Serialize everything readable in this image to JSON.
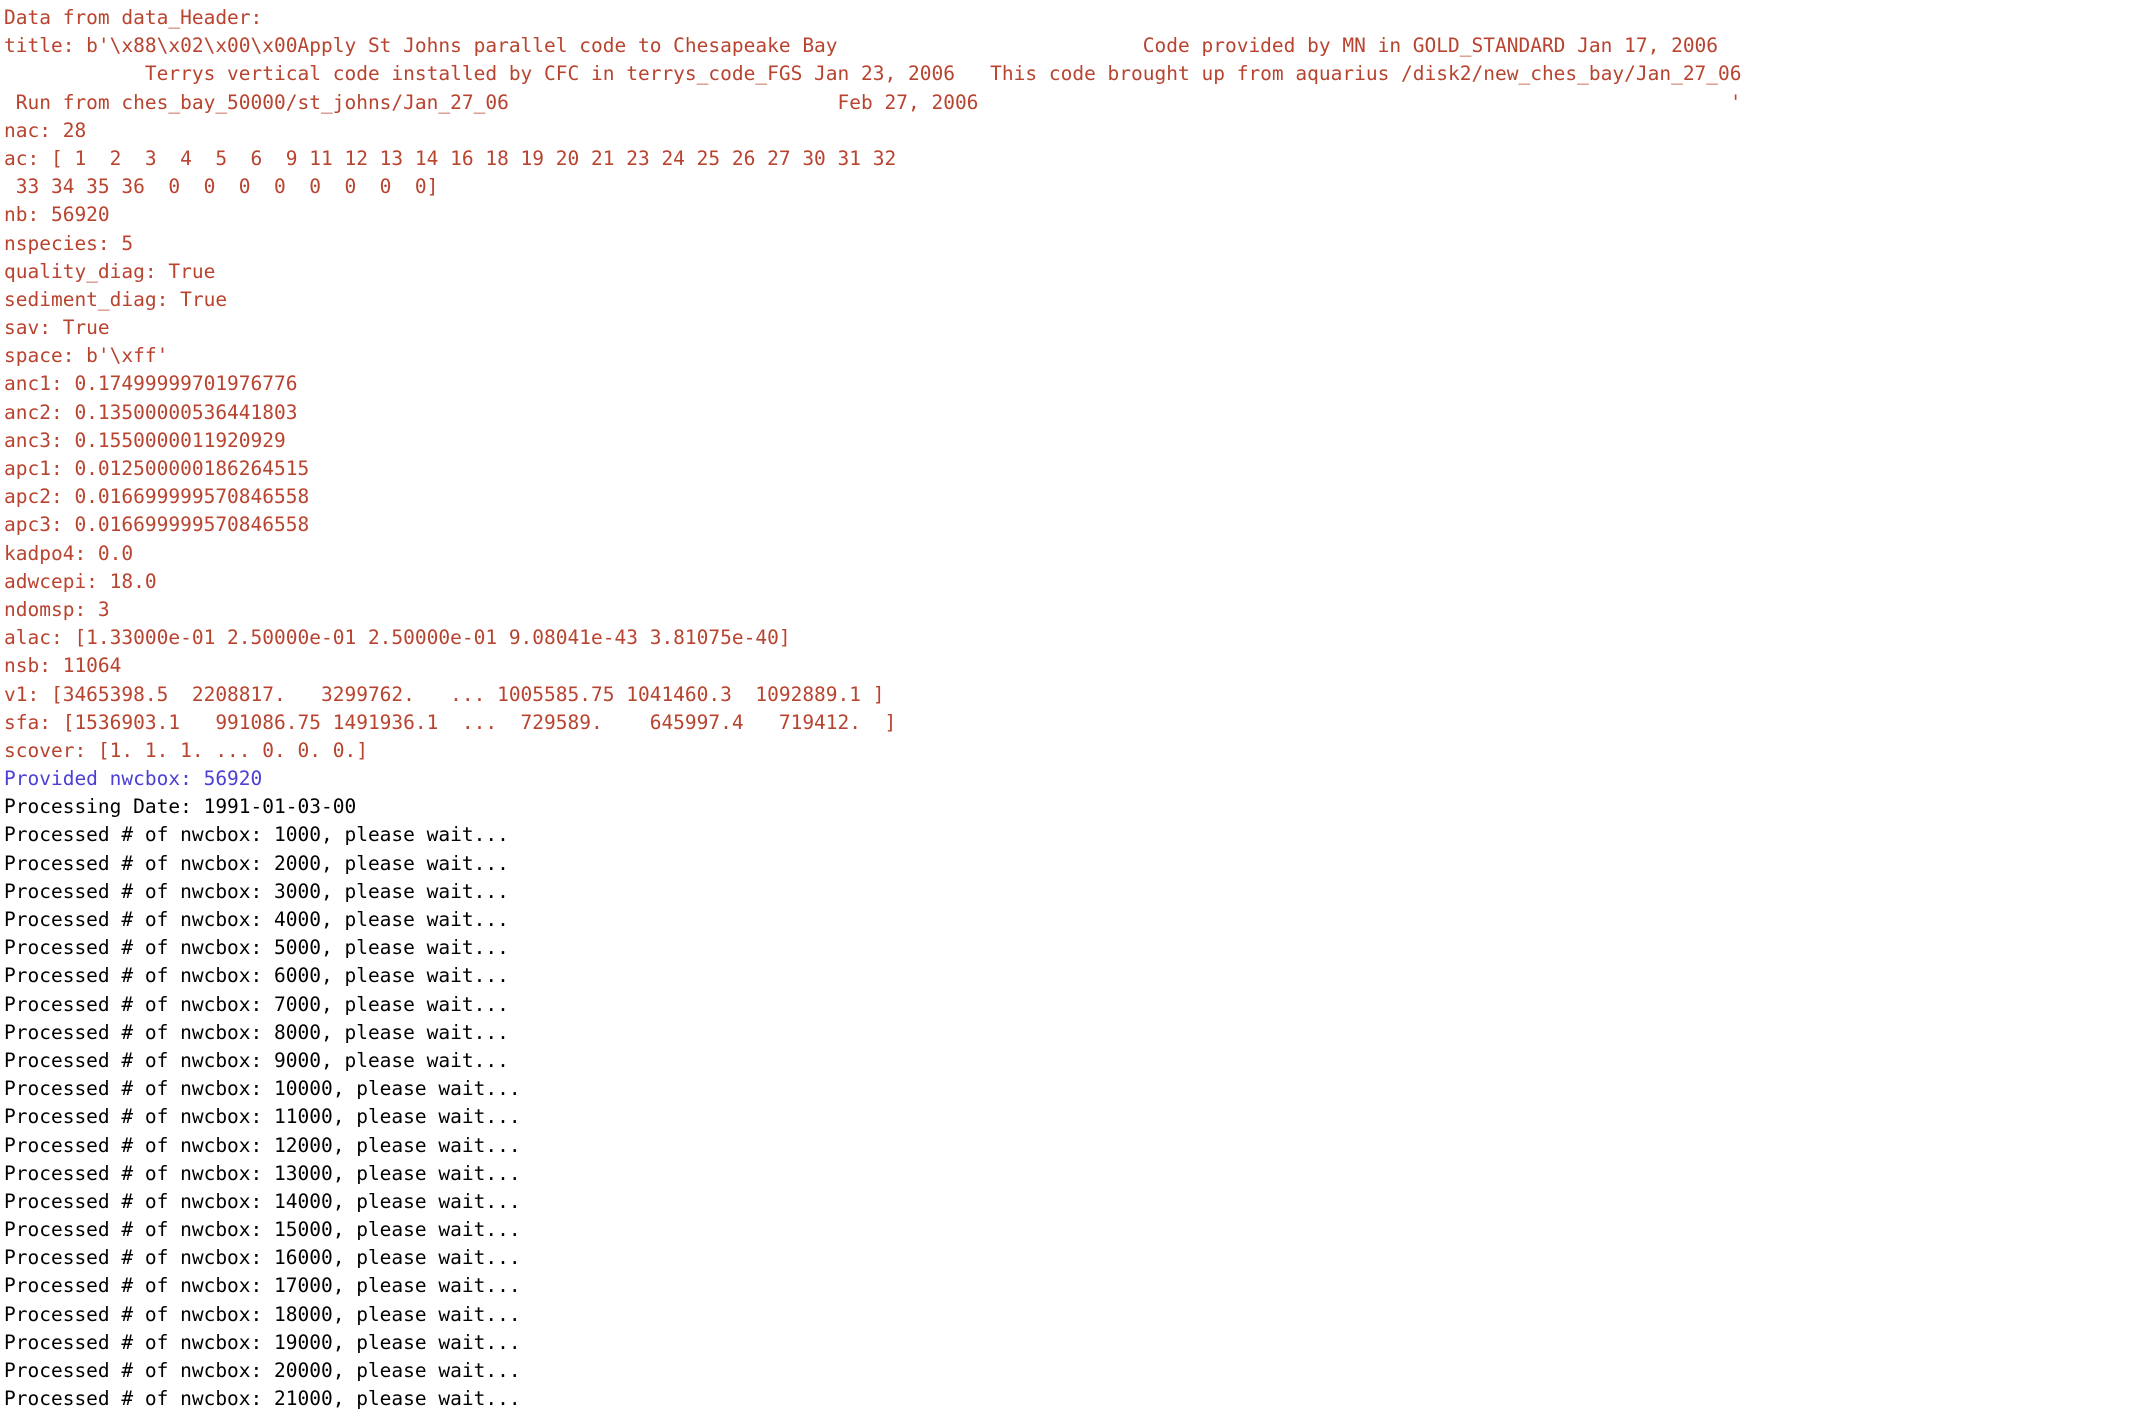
{
  "terminal": {
    "background_color": "#ffffff",
    "colors": {
      "stderr": "#b8432f",
      "info": "#4b3fd4",
      "stdout": "#000000"
    },
    "font_size_px": 19.5,
    "line_height_px": 28.2
  },
  "lines": [
    {
      "stream": "stderr",
      "text": "Data from data_Header:"
    },
    {
      "stream": "stderr",
      "text": "title: b'\\x88\\x02\\x00\\x00Apply St Johns parallel code to Chesapeake Bay                          Code provided by MN in GOLD_STANDARD Jan 17, 2006"
    },
    {
      "stream": "stderr",
      "text": "            Terrys vertical code installed by CFC in terrys_code_FGS Jan 23, 2006   This code brought up from aquarius /disk2/new_ches_bay/Jan_27_06"
    },
    {
      "stream": "stderr",
      "text": " Run from ches_bay_50000/st_johns/Jan_27_06                            Feb 27, 2006                                                                '"
    },
    {
      "stream": "stderr",
      "text": "nac: 28"
    },
    {
      "stream": "stderr",
      "text": "ac: [ 1  2  3  4  5  6  9 11 12 13 14 16 18 19 20 21 23 24 25 26 27 30 31 32"
    },
    {
      "stream": "stderr",
      "text": " 33 34 35 36  0  0  0  0  0  0  0  0]"
    },
    {
      "stream": "stderr",
      "text": "nb: 56920"
    },
    {
      "stream": "stderr",
      "text": "nspecies: 5"
    },
    {
      "stream": "stderr",
      "text": "quality_diag: True"
    },
    {
      "stream": "stderr",
      "text": "sediment_diag: True"
    },
    {
      "stream": "stderr",
      "text": "sav: True"
    },
    {
      "stream": "stderr",
      "text": "space: b'\\xff'"
    },
    {
      "stream": "stderr",
      "text": "anc1: 0.17499999701976776"
    },
    {
      "stream": "stderr",
      "text": "anc2: 0.13500000536441803"
    },
    {
      "stream": "stderr",
      "text": "anc3: 0.1550000011920929"
    },
    {
      "stream": "stderr",
      "text": "apc1: 0.012500000186264515"
    },
    {
      "stream": "stderr",
      "text": "apc2: 0.016699999570846558"
    },
    {
      "stream": "stderr",
      "text": "apc3: 0.016699999570846558"
    },
    {
      "stream": "stderr",
      "text": "kadpo4: 0.0"
    },
    {
      "stream": "stderr",
      "text": "adwcepi: 18.0"
    },
    {
      "stream": "stderr",
      "text": "ndomsp: 3"
    },
    {
      "stream": "stderr",
      "text": "alac: [1.33000e-01 2.50000e-01 2.50000e-01 9.08041e-43 3.81075e-40]"
    },
    {
      "stream": "stderr",
      "text": "nsb: 11064"
    },
    {
      "stream": "stderr",
      "text": "v1: [3465398.5  2208817.   3299762.   ... 1005585.75 1041460.3  1092889.1 ]"
    },
    {
      "stream": "stderr",
      "text": "sfa: [1536903.1   991086.75 1491936.1  ...  729589.    645997.4   719412.  ]"
    },
    {
      "stream": "stderr",
      "text": "scover: [1. 1. 1. ... 0. 0. 0.]"
    },
    {
      "stream": "info",
      "text": "Provided nwcbox: 56920"
    },
    {
      "stream": "stdout",
      "text": "Processing Date: 1991-01-03-00"
    },
    {
      "stream": "stdout",
      "text": "Processed # of nwcbox: 1000, please wait..."
    },
    {
      "stream": "stdout",
      "text": "Processed # of nwcbox: 2000, please wait..."
    },
    {
      "stream": "stdout",
      "text": "Processed # of nwcbox: 3000, please wait..."
    },
    {
      "stream": "stdout",
      "text": "Processed # of nwcbox: 4000, please wait..."
    },
    {
      "stream": "stdout",
      "text": "Processed # of nwcbox: 5000, please wait..."
    },
    {
      "stream": "stdout",
      "text": "Processed # of nwcbox: 6000, please wait..."
    },
    {
      "stream": "stdout",
      "text": "Processed # of nwcbox: 7000, please wait..."
    },
    {
      "stream": "stdout",
      "text": "Processed # of nwcbox: 8000, please wait..."
    },
    {
      "stream": "stdout",
      "text": "Processed # of nwcbox: 9000, please wait..."
    },
    {
      "stream": "stdout",
      "text": "Processed # of nwcbox: 10000, please wait..."
    },
    {
      "stream": "stdout",
      "text": "Processed # of nwcbox: 11000, please wait..."
    },
    {
      "stream": "stdout",
      "text": "Processed # of nwcbox: 12000, please wait..."
    },
    {
      "stream": "stdout",
      "text": "Processed # of nwcbox: 13000, please wait..."
    },
    {
      "stream": "stdout",
      "text": "Processed # of nwcbox: 14000, please wait..."
    },
    {
      "stream": "stdout",
      "text": "Processed # of nwcbox: 15000, please wait..."
    },
    {
      "stream": "stdout",
      "text": "Processed # of nwcbox: 16000, please wait..."
    },
    {
      "stream": "stdout",
      "text": "Processed # of nwcbox: 17000, please wait..."
    },
    {
      "stream": "stdout",
      "text": "Processed # of nwcbox: 18000, please wait..."
    },
    {
      "stream": "stdout",
      "text": "Processed # of nwcbox: 19000, please wait..."
    },
    {
      "stream": "stdout",
      "text": "Processed # of nwcbox: 20000, please wait..."
    },
    {
      "stream": "stdout",
      "text": "Processed # of nwcbox: 21000, please wait..."
    }
  ]
}
